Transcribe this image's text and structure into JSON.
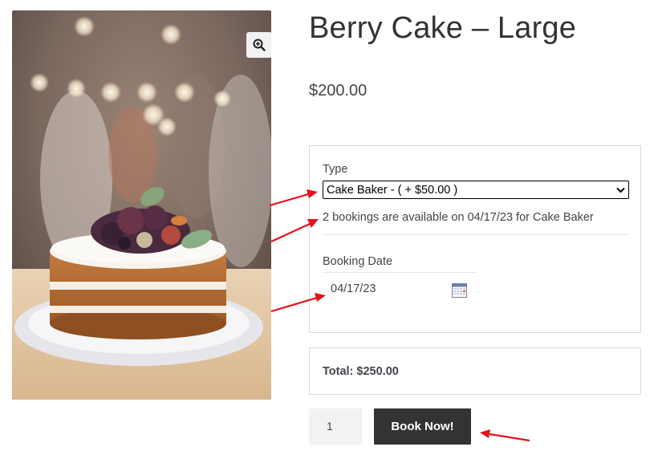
{
  "product": {
    "title": "Berry Cake – Large",
    "price": "$200.00",
    "image": {
      "subject": "cake-photo",
      "zoom_icon": "zoom-in-icon"
    }
  },
  "booking": {
    "type_label": "Type",
    "type_selected": "Cake Baker - ( + $50.00 )",
    "availability_text": "2 bookings are available on 04/17/23 for Cake Baker",
    "date_label": "Booking Date",
    "date_value": "04/17/23",
    "calendar_icon": "calendar-icon"
  },
  "total": {
    "text": "Total: $250.00"
  },
  "cart": {
    "quantity": "1",
    "book_button_label": "Book Now!"
  },
  "annotations": {
    "arrow_color": "#e8101a"
  },
  "colors": {
    "button_bg": "#333333",
    "border": "#d9d9d9",
    "text": "#43454b"
  }
}
